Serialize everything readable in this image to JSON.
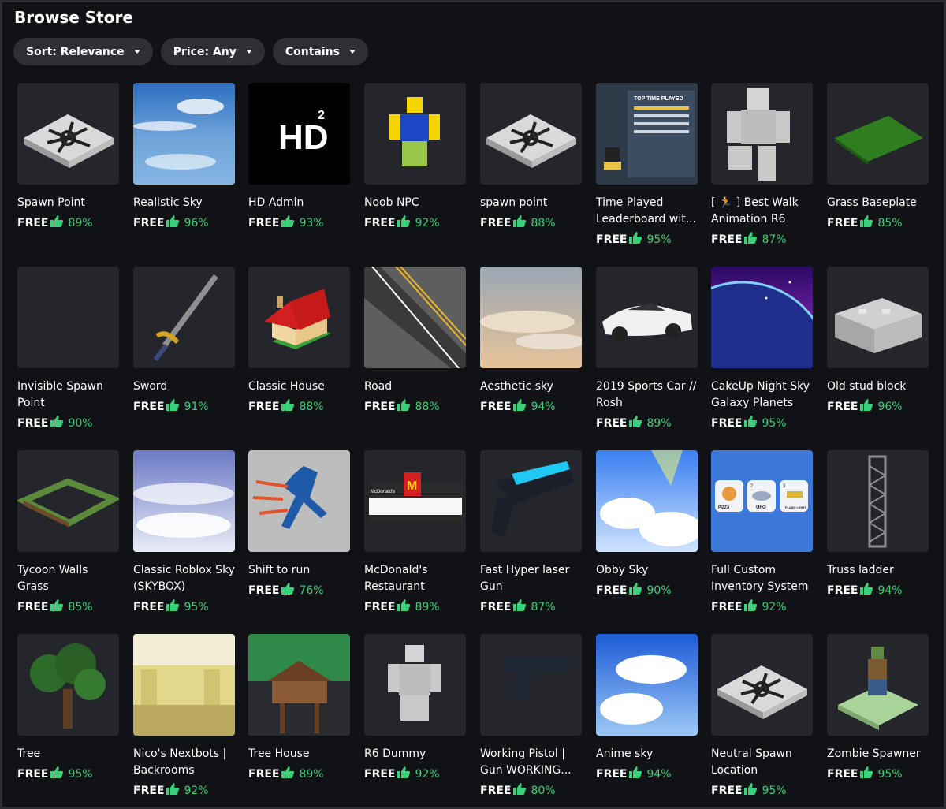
{
  "page": {
    "title": "Browse Store"
  },
  "filters": [
    {
      "label": "Sort: Relevance"
    },
    {
      "label": "Price: Any"
    },
    {
      "label": "Contains"
    }
  ],
  "colors": {
    "background": "#111216",
    "tile": "#24262b",
    "pill": "#2e2f35",
    "rating": "#3bd17a"
  },
  "items": [
    {
      "name": "Spawn Point",
      "price": "FREE",
      "rating": "89%",
      "thumb": "spawn-pad"
    },
    {
      "name": "Realistic Sky",
      "price": "FREE",
      "rating": "96%",
      "thumb": "sky-blue"
    },
    {
      "name": "HD Admin",
      "price": "FREE",
      "rating": "93%",
      "thumb": "hd-logo",
      "logo_text": "HD",
      "logo_sup": "2"
    },
    {
      "name": "Noob NPC",
      "price": "FREE",
      "rating": "92%",
      "thumb": "noob"
    },
    {
      "name": "spawn point",
      "price": "FREE",
      "rating": "88%",
      "thumb": "spawn-pad"
    },
    {
      "name": "Time Played\nLeaderboard wit...",
      "price": "FREE",
      "rating": "95%",
      "thumb": "leaderboard",
      "board_text": "TOP TIME PLAYED"
    },
    {
      "name": "[ 🏃 ] Best Walk\nAnimation R6",
      "price": "FREE",
      "rating": "87%",
      "thumb": "grey-figure"
    },
    {
      "name": "Grass Baseplate",
      "price": "FREE",
      "rating": "85%",
      "thumb": "grass-plate"
    },
    {
      "name": "Invisible Spawn\nPoint",
      "price": "FREE",
      "rating": "90%",
      "thumb": "blank"
    },
    {
      "name": "Sword",
      "price": "FREE",
      "rating": "91%",
      "thumb": "sword"
    },
    {
      "name": "Classic House",
      "price": "FREE",
      "rating": "88%",
      "thumb": "house"
    },
    {
      "name": "Road",
      "price": "FREE",
      "rating": "88%",
      "thumb": "road"
    },
    {
      "name": "Aesthetic sky",
      "price": "FREE",
      "rating": "94%",
      "thumb": "sky-sunset"
    },
    {
      "name": "2019 Sports Car //\nRosh",
      "price": "FREE",
      "rating": "89%",
      "thumb": "car"
    },
    {
      "name": "CakeUp Night Sky\nGalaxy Planets",
      "price": "FREE",
      "rating": "95%",
      "thumb": "galaxy"
    },
    {
      "name": "Old stud block",
      "price": "FREE",
      "rating": "96%",
      "thumb": "stud-block"
    },
    {
      "name": "Tycoon Walls\nGrass",
      "price": "FREE",
      "rating": "85%",
      "thumb": "tycoon-walls"
    },
    {
      "name": "Classic Roblox Sky\n(SKYBOX)",
      "price": "FREE",
      "rating": "95%",
      "thumb": "sky-classic"
    },
    {
      "name": "Shift to run",
      "price": "FREE",
      "rating": "76%",
      "thumb": "runner"
    },
    {
      "name": "McDonald's\nRestaurant",
      "price": "FREE",
      "rating": "89%",
      "thumb": "restaurant",
      "sign_text": "McDonald's"
    },
    {
      "name": "Fast Hyper laser\nGun",
      "price": "FREE",
      "rating": "87%",
      "thumb": "laser-gun"
    },
    {
      "name": "Obby Sky",
      "price": "FREE",
      "rating": "90%",
      "thumb": "sky-rainbow"
    },
    {
      "name": "Full Custom\nInventory System",
      "price": "FREE",
      "rating": "92%",
      "thumb": "inventory",
      "slot_labels": [
        "PIZZA",
        "UFO",
        "FLASH LIGHT"
      ],
      "slot_numbers": [
        "2",
        "3"
      ]
    },
    {
      "name": "Truss ladder",
      "price": "FREE",
      "rating": "94%",
      "thumb": "truss"
    },
    {
      "name": "Tree",
      "price": "FREE",
      "rating": "95%",
      "thumb": "tree"
    },
    {
      "name": "Nico's Nextbots |\nBackrooms",
      "price": "FREE",
      "rating": "92%",
      "thumb": "backrooms"
    },
    {
      "name": "Tree House",
      "price": "FREE",
      "rating": "89%",
      "thumb": "treehouse"
    },
    {
      "name": "R6 Dummy",
      "price": "FREE",
      "rating": "92%",
      "thumb": "dummy"
    },
    {
      "name": "Working Pistol |\nGun WORKING...",
      "price": "FREE",
      "rating": "80%",
      "thumb": "pistol"
    },
    {
      "name": "Anime sky",
      "price": "FREE",
      "rating": "94%",
      "thumb": "sky-anime"
    },
    {
      "name": "Neutral Spawn\nLocation",
      "price": "FREE",
      "rating": "95%",
      "thumb": "spawn-pad"
    },
    {
      "name": "Zombie Spawner",
      "price": "FREE",
      "rating": "95%",
      "thumb": "zombie-spawner"
    }
  ]
}
